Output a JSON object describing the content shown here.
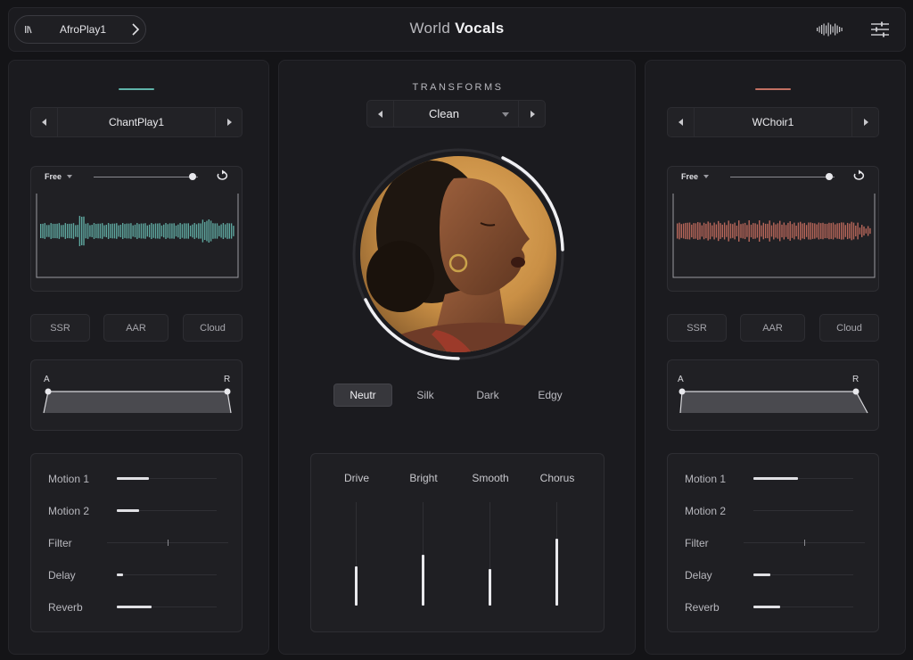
{
  "header": {
    "preset_name": "AfroPlay1",
    "title_light": "World",
    "title_bold": "Vocals",
    "icons": [
      "library-icon",
      "chevron-right-icon",
      "waveform-icon",
      "sliders-icon"
    ]
  },
  "left": {
    "accent_color": "#5fb3a9",
    "preset": "ChantPlay1",
    "wave_mode": "Free",
    "wave_color": "#5fa8a0",
    "start_position": 0.95,
    "modes": [
      "SSR",
      "AAR",
      "Cloud"
    ],
    "env": {
      "a": "A",
      "r": "R"
    },
    "macros": [
      {
        "label": "Motion 1",
        "value": 0.32
      },
      {
        "label": "Motion 2",
        "value": 0.22
      },
      {
        "label": "Filter",
        "value": 0.5
      },
      {
        "label": "Delay",
        "value": 0.06
      },
      {
        "label": "Reverb",
        "value": 0.35
      }
    ]
  },
  "center": {
    "transforms_label": "TRANSFORMS",
    "transform": "Clean",
    "tones": [
      "Neutr",
      "Silk",
      "Dark",
      "Edgy"
    ],
    "active_tone": "Neutr",
    "faders": [
      {
        "label": "Drive",
        "value": 0.38
      },
      {
        "label": "Bright",
        "value": 0.49
      },
      {
        "label": "Smooth",
        "value": 0.35
      },
      {
        "label": "Chorus",
        "value": 0.65
      }
    ]
  },
  "right": {
    "accent_color": "#c27062",
    "preset": "WChoir1",
    "wave_mode": "Free",
    "wave_color": "#b8675a",
    "start_position": 0.95,
    "modes": [
      "SSR",
      "AAR",
      "Cloud"
    ],
    "env": {
      "a": "A",
      "r": "R"
    },
    "macros": [
      {
        "label": "Motion 1",
        "value": 0.45
      },
      {
        "label": "Motion 2",
        "value": 0.0
      },
      {
        "label": "Filter",
        "value": 0.5
      },
      {
        "label": "Delay",
        "value": 0.17
      },
      {
        "label": "Reverb",
        "value": 0.27
      }
    ]
  }
}
